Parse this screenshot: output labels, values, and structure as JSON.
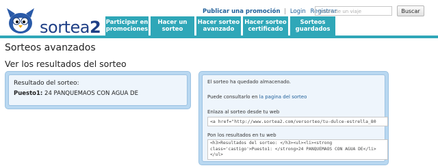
{
  "brand": {
    "name_main": "sortea",
    "name_suffix": "2"
  },
  "top_links": {
    "publish": "Publicar una promoción",
    "sep": "|",
    "login": "Login",
    "register": "Registrar"
  },
  "search": {
    "placeholder": "sorteo de un viaje",
    "button": "Buscar"
  },
  "nav": [
    {
      "label": "Participar en\npromociones"
    },
    {
      "label": "Hacer un\nsorteo"
    },
    {
      "label": "Hacer sorteo\navanzado"
    },
    {
      "label": "Hacer sorteo\ncertificado"
    },
    {
      "label": "Sorteos\nguardados"
    }
  ],
  "page": {
    "title": "Sorteos avanzados",
    "section_title": "Ver los resultados del sorteo"
  },
  "results": {
    "title": "Resultado del sorteo:",
    "position_label": "Puesto1:",
    "position_value": "24 PANQUEMAOS CON AGUA DE"
  },
  "share": {
    "stored_msg": "El sorteo ha quedado almacenado.",
    "consult_prefix": "Puede consultarlo en",
    "consult_link": "la pagina del sorteo",
    "link_label": "Enlaza al sorteo desde tu web",
    "link_code": "<a href=\"http://www.sortea2.com/versorteo/tu-dulce-estrella_80",
    "web_label": "Pon los resultados en tu web",
    "web_code": "<h3>Resultados del sorteo: </h3><ul><li><strong class='castigo'>Puesto1: </strong>24 PANQUEMAOS CON AGUA DE</li></ul>"
  },
  "colors": {
    "nav": "#2fa7b8",
    "panel": "#b9d8f1",
    "brand": "#1f3f86",
    "link": "#1f5f99"
  }
}
